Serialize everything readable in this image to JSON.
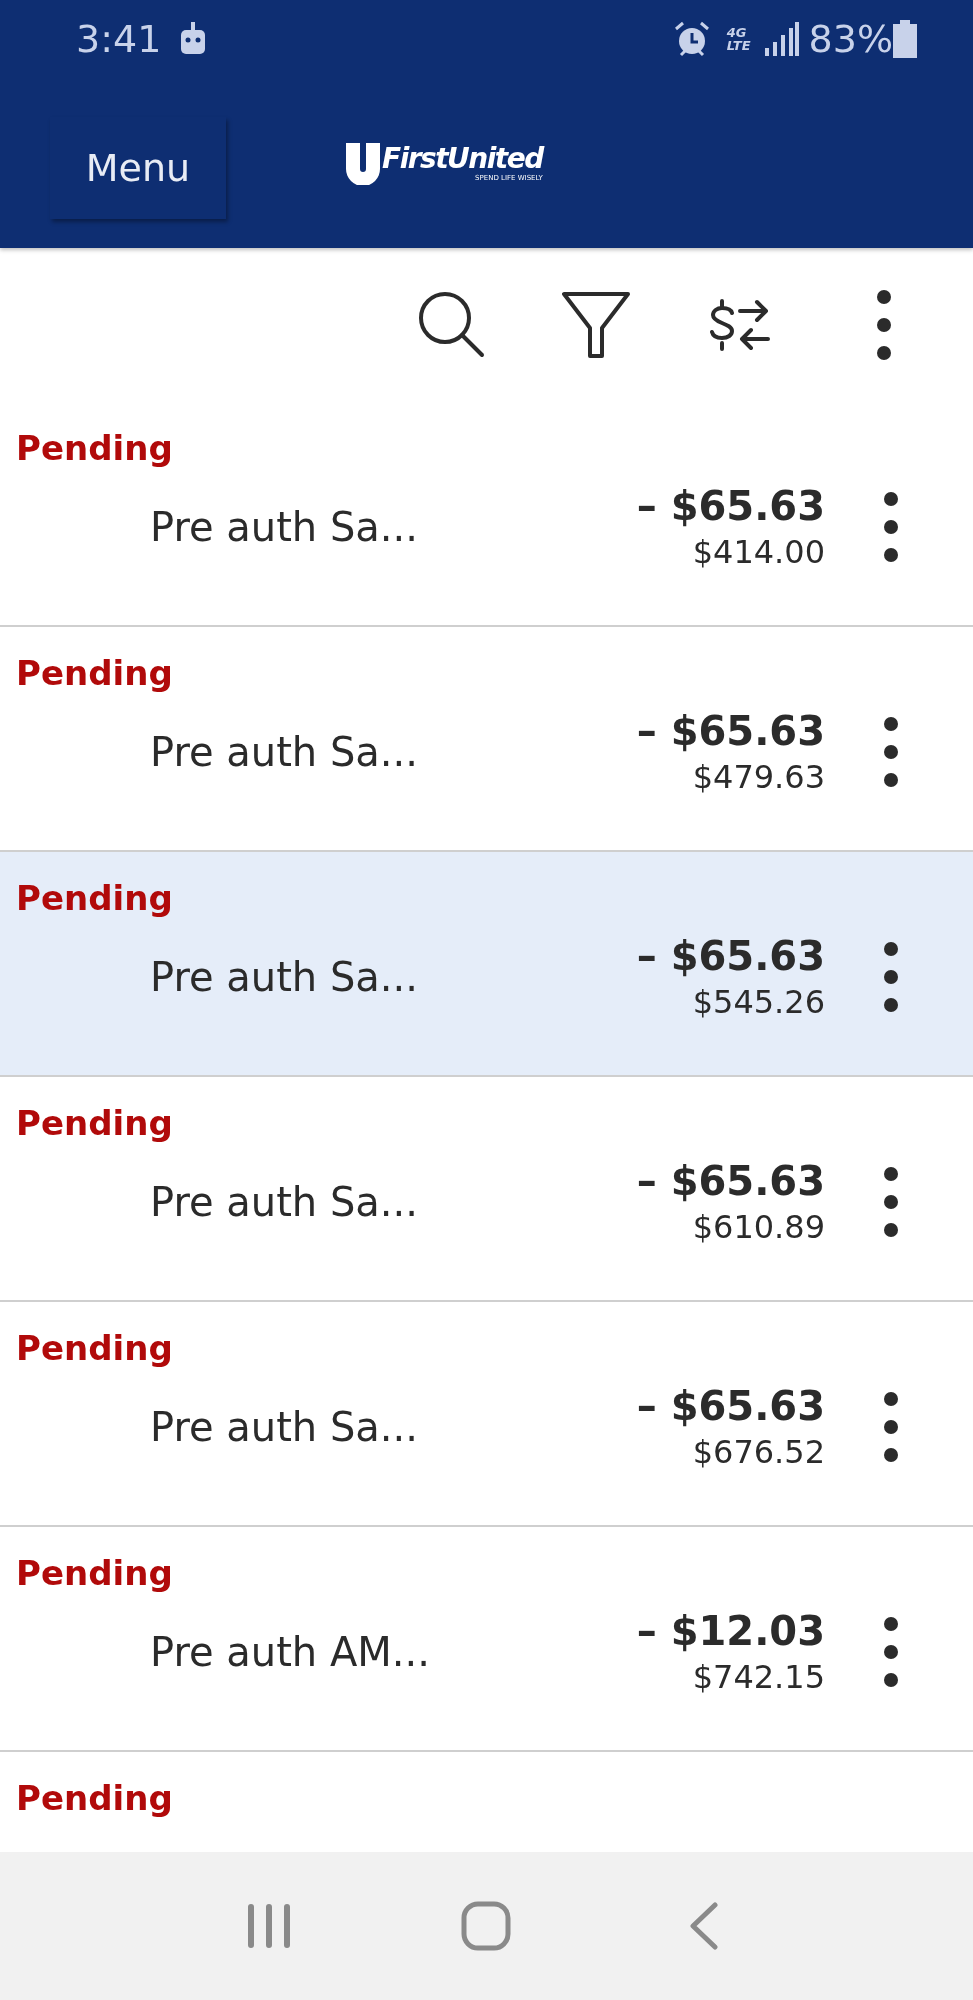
{
  "status_bar": {
    "time": "3:41",
    "network": [
      "4G",
      "LTE"
    ],
    "battery": "83%"
  },
  "header": {
    "menu_button": "Menu",
    "logo": {
      "name": "FirstUnited",
      "tagline": "SPEND LIFE WISELY"
    }
  },
  "transactions": [
    {
      "status": "Pending",
      "description": "Pre auth Sa...",
      "amount": "– $65.63",
      "balance": "$414.00",
      "selected": false
    },
    {
      "status": "Pending",
      "description": "Pre auth Sa...",
      "amount": "– $65.63",
      "balance": "$479.63",
      "selected": false
    },
    {
      "status": "Pending",
      "description": "Pre auth Sa...",
      "amount": "– $65.63",
      "balance": "$545.26",
      "selected": true
    },
    {
      "status": "Pending",
      "description": "Pre auth Sa...",
      "amount": "– $65.63",
      "balance": "$610.89",
      "selected": false
    },
    {
      "status": "Pending",
      "description": "Pre auth Sa...",
      "amount": "– $65.63",
      "balance": "$676.52",
      "selected": false
    },
    {
      "status": "Pending",
      "description": "Pre auth AM...",
      "amount": "– $12.03",
      "balance": "$742.15",
      "selected": false
    },
    {
      "status": "Pending",
      "selected": false
    }
  ]
}
